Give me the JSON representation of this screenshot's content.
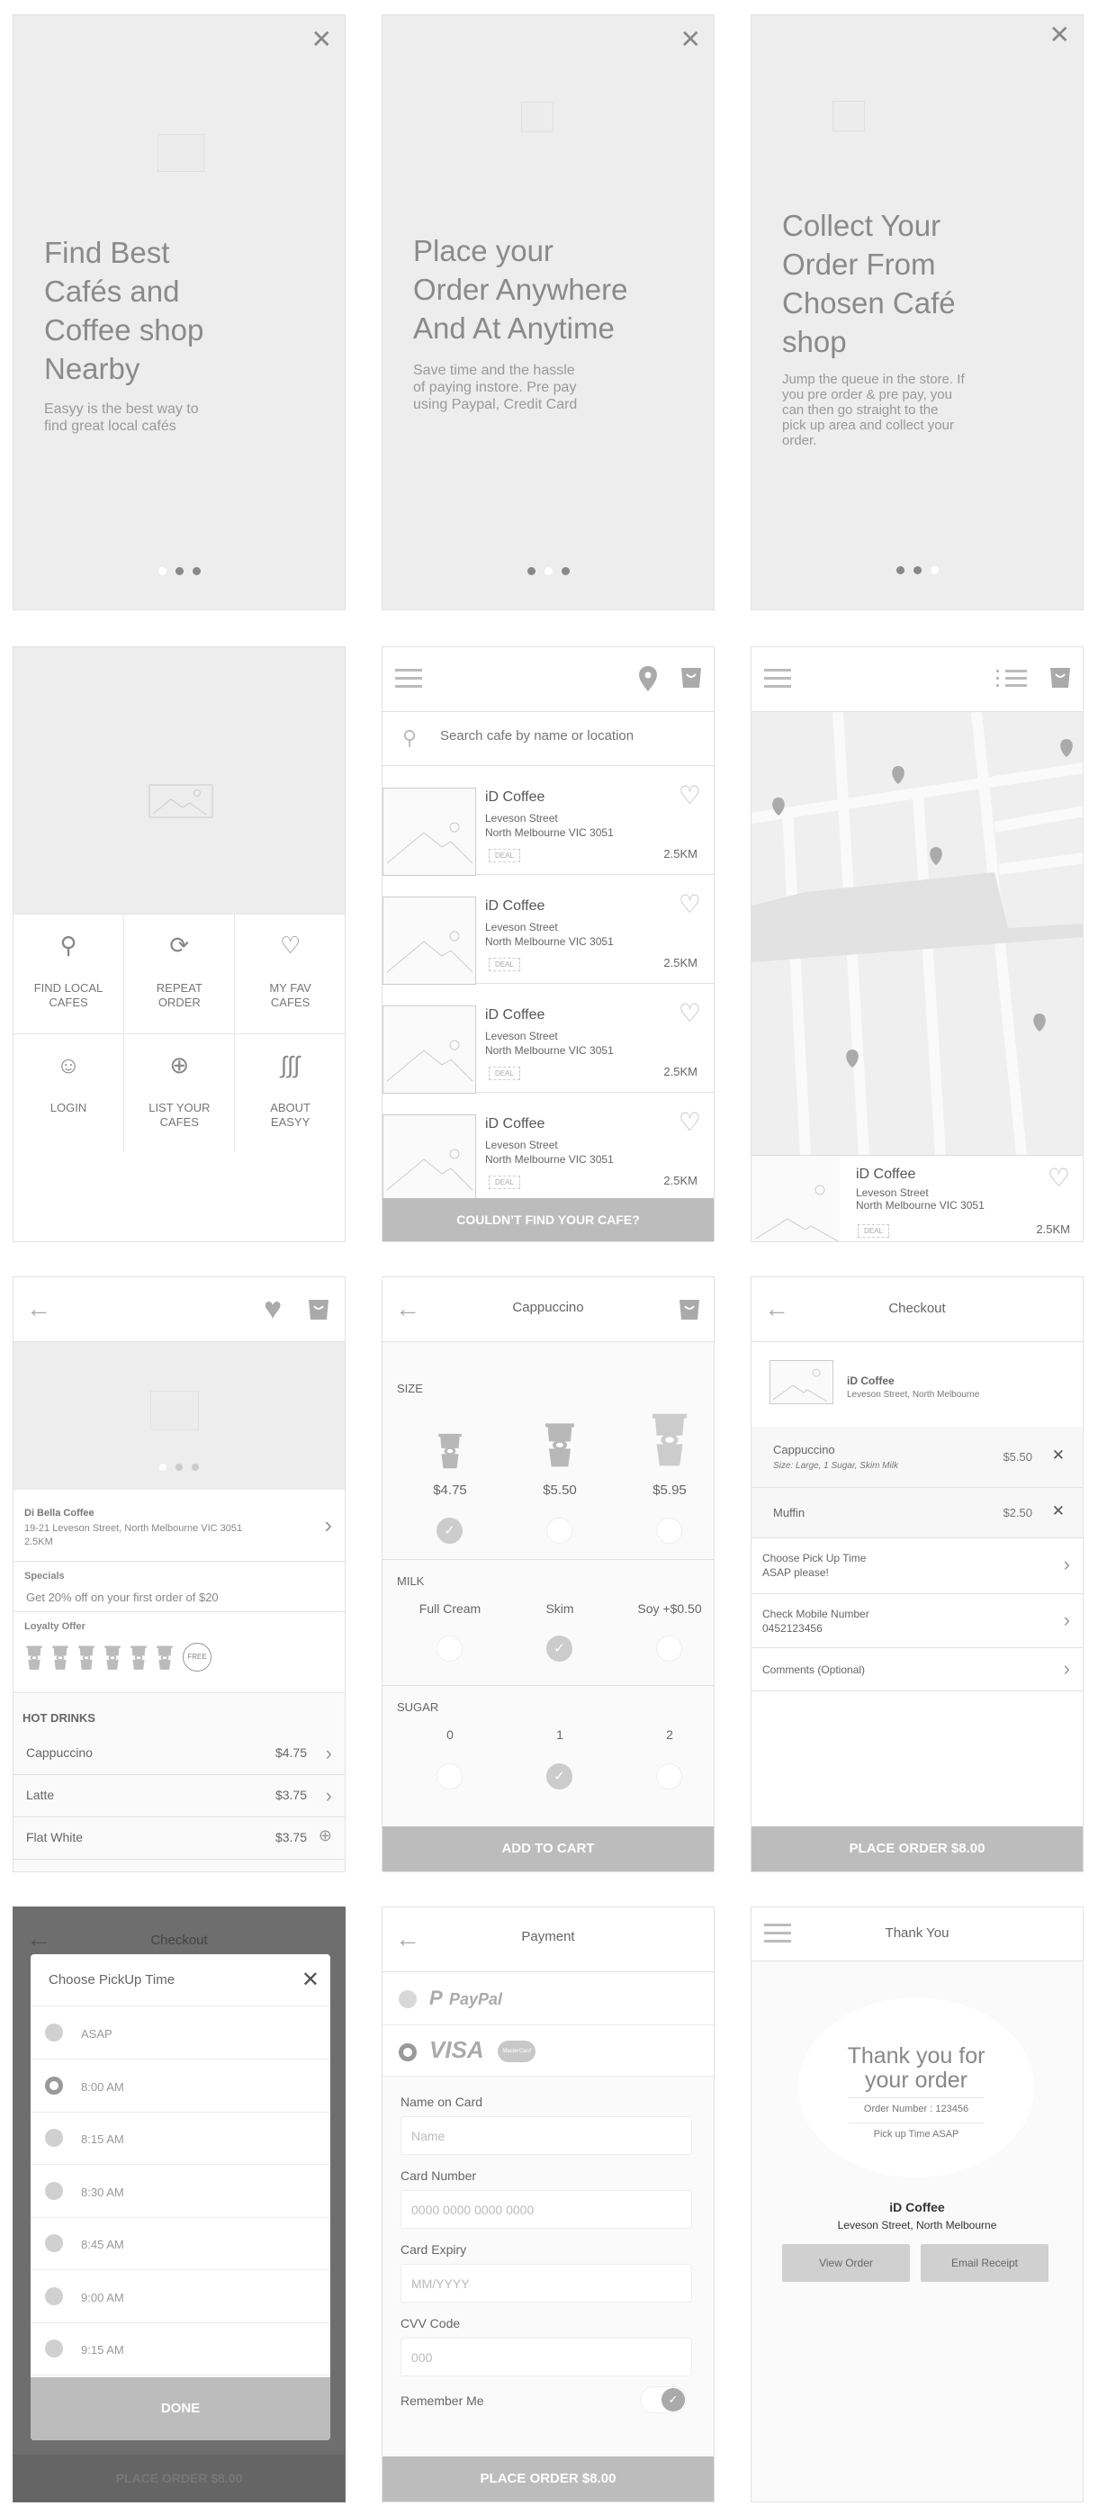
{
  "onboarding": [
    {
      "title_lines": [
        "Find Best",
        "Cafés and",
        "Coffee shop",
        "Nearby"
      ],
      "subtitle_lines": [
        "Easyy is the best way to",
        "find great local cafés"
      ],
      "active_dot": 0
    },
    {
      "title_lines": [
        "Place your",
        "Order Anywhere",
        "And At Anytime"
      ],
      "subtitle_lines": [
        "Save time and the hassle",
        "of paying instore. Pre pay",
        "using Paypal, Credit Card"
      ],
      "active_dot": 1
    },
    {
      "title_lines": [
        "Collect Your",
        "Order From",
        "Chosen Café",
        "shop"
      ],
      "subtitle_lines": [
        "Jump the queue in the store. If",
        "you pre order & pre pay, you",
        "can then go straight  to the",
        "pick up area and collect your",
        "order."
      ],
      "active_dot": 2
    }
  ],
  "home_menu": {
    "tiles": [
      {
        "icon": "search-icon",
        "glyph": "⚲",
        "line1": "FIND LOCAL",
        "line2": "CAFES"
      },
      {
        "icon": "refresh-icon",
        "glyph": "⟳",
        "line1": "REPEAT",
        "line2": "ORDER"
      },
      {
        "icon": "heart-icon",
        "glyph": "♡",
        "line1": "MY FAV",
        "line2": "CAFES"
      },
      {
        "icon": "user-icon",
        "glyph": "☺",
        "line1": "LOGIN",
        "line2": ""
      },
      {
        "icon": "plus-circle-icon",
        "glyph": "⊕",
        "line1": "LIST YOUR",
        "line2": "CAFES"
      },
      {
        "icon": "steam-icon",
        "glyph": "∫∫∫",
        "line1": "ABOUT",
        "line2": "EASYY"
      }
    ]
  },
  "cafe_list": {
    "search_placeholder": "Search cafe by name or location",
    "cafes": [
      {
        "name": "iD Coffee",
        "street": "Leveson Street",
        "suburb": "North Melbourne VIC 3051",
        "badge": "DEAL",
        "distance": "2.5KM"
      },
      {
        "name": "iD Coffee",
        "street": "Leveson Street",
        "suburb": "North Melbourne VIC 3051",
        "badge": "DEAL",
        "distance": "2.5KM"
      },
      {
        "name": "iD Coffee",
        "street": "Leveson Street",
        "suburb": "North Melbourne VIC 3051",
        "badge": "DEAL",
        "distance": "2.5KM"
      },
      {
        "name": "iD Coffee",
        "street": "Leveson Street",
        "suburb": "North Melbourne VIC 3051",
        "badge": "DEAL",
        "distance": "2.5KM"
      }
    ],
    "footer_button": "COULDN’T FIND YOUR CAFE?"
  },
  "map_view": {
    "cafe": {
      "name": "iD Coffee",
      "street": "Leveson Street",
      "suburb": "North Melbourne VIC 3051",
      "badge": "DEAL",
      "distance": "2.5KM"
    }
  },
  "cafe_detail": {
    "name": "Di Bella Coffee",
    "address": "19-21 Leveson Street, North Melbourne VIC 3051",
    "distance": "2.5KM",
    "specials_label": "Specials",
    "specials_text": "Get 20% off on your first order of $20",
    "loyalty_label": "Loyalty Offer",
    "loyalty_stamps": 6,
    "loyalty_free": "FREE",
    "section_title": "HOT DRINKS",
    "menu": [
      {
        "name": "Cappuccino",
        "price": "$4.75",
        "action": "chevron"
      },
      {
        "name": "Latte",
        "price": "$3.75",
        "action": "chevron"
      },
      {
        "name": "Flat White",
        "price": "$3.75",
        "action": "add"
      }
    ]
  },
  "product": {
    "title": "Cappuccino",
    "size_label": "SIZE",
    "sizes": [
      {
        "price": "$4.75",
        "selected": true
      },
      {
        "price": "$5.50",
        "selected": false
      },
      {
        "price": "$5.95",
        "selected": false
      }
    ],
    "milk_label": "MILK",
    "milks": [
      {
        "label": "Full Cream",
        "selected": false
      },
      {
        "label": "Skim",
        "selected": true
      },
      {
        "label": "Soy +$0.50",
        "selected": false
      }
    ],
    "sugar_label": "SUGAR",
    "sugars": [
      {
        "label": "0",
        "selected": false
      },
      {
        "label": "1",
        "selected": true
      },
      {
        "label": "2",
        "selected": false
      }
    ],
    "add_button": "ADD TO CART"
  },
  "checkout": {
    "title": "Checkout",
    "cafe_name": "iD Coffee",
    "cafe_address": "Leveson Street, North Melbourne",
    "items": [
      {
        "name": "Cappuccino",
        "detail": "Size: Large, 1 Sugar, Skim Milk",
        "price": "$5.50"
      },
      {
        "name": "Muffin",
        "detail": "",
        "price": "$2.50"
      }
    ],
    "rows": [
      {
        "label": "Choose Pick Up Time",
        "value": "ASAP please!"
      },
      {
        "label": "Check Mobile Number",
        "value": "0452123456"
      },
      {
        "label": "Comments (Optional)",
        "value": ""
      }
    ],
    "place_order": "PLACE ORDER $8.00"
  },
  "pickup_modal": {
    "bg_title": "Checkout",
    "title": "Choose PickUp Time",
    "options": [
      {
        "label": "ASAP",
        "selected": false
      },
      {
        "label": "8:00 AM",
        "selected": true
      },
      {
        "label": "8:15 AM",
        "selected": false
      },
      {
        "label": "8:30 AM",
        "selected": false
      },
      {
        "label": "8:45 AM",
        "selected": false
      },
      {
        "label": "9:00 AM",
        "selected": false
      },
      {
        "label": "9:15 AM",
        "selected": false
      }
    ],
    "done": "DONE",
    "bg_button": "PLACE ORDER $8.00"
  },
  "payment": {
    "title": "Payment",
    "paypal": "PayPal",
    "visa": "VISA",
    "mastercard": "MasterCard",
    "fields": [
      {
        "label": "Name on Card",
        "placeholder": "Name"
      },
      {
        "label": "Card Number",
        "placeholder": "0000 0000 0000 0000"
      },
      {
        "label": "Card Expiry",
        "placeholder": "MM/YYYY"
      },
      {
        "label": "CVV Code",
        "placeholder": "000"
      }
    ],
    "remember_label": "Remember Me",
    "remember_on": true,
    "place_order": "PLACE ORDER $8.00"
  },
  "thank_you": {
    "title": "Thank You",
    "heading_line1": "Thank you for",
    "heading_line2": "your order",
    "order_number": "Order Number : 123456",
    "pickup": "Pick up Time ASAP",
    "cafe_name": "iD Coffee",
    "cafe_address": "Leveson Street, North Melbourne",
    "view_order": "View Order",
    "email_receipt": "Email Receipt"
  }
}
